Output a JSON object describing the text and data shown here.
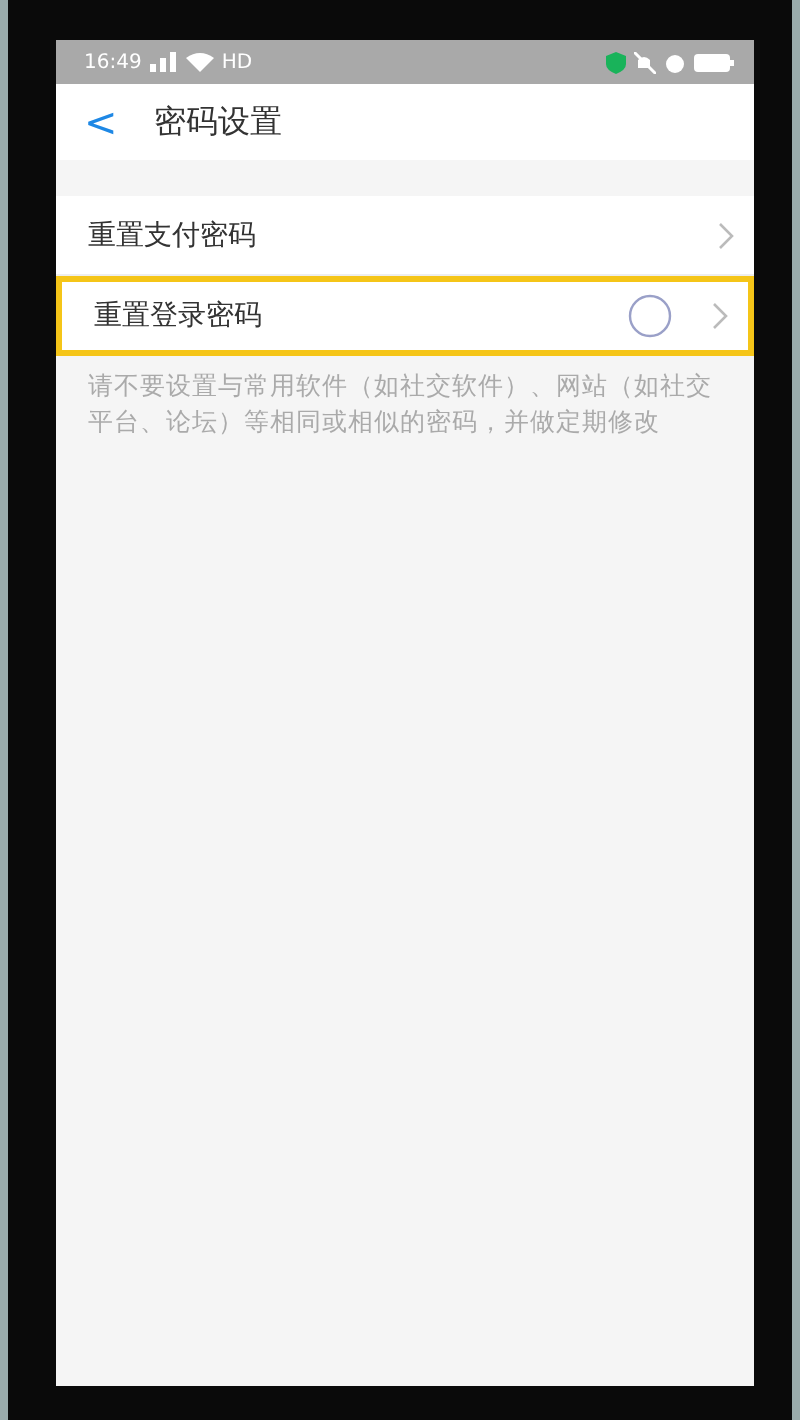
{
  "status_bar": {
    "time": "16:49",
    "network": "HD"
  },
  "header": {
    "back": "<",
    "title": "密码设置"
  },
  "rows": [
    {
      "label": "重置支付密码",
      "highlighted": false,
      "touched": false
    },
    {
      "label": "重置登录密码",
      "highlighted": true,
      "touched": true
    }
  ],
  "hint": "请不要设置与常用软件（如社交软件）、网站（如社交平台、论坛）等相同或相似的密码，并做定期修改"
}
